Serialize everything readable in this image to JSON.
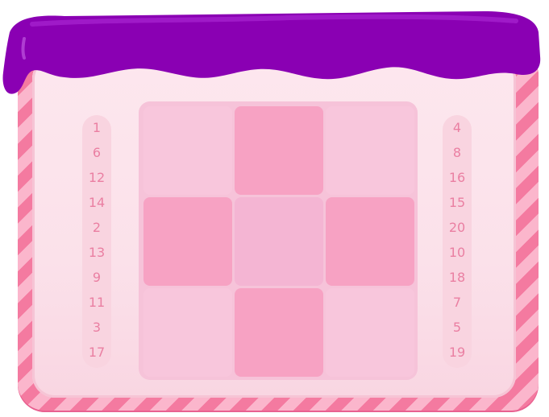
{
  "left_numbers": [
    "1",
    "6",
    "12",
    "14",
    "2",
    "13",
    "9",
    "11",
    "3",
    "17"
  ],
  "right_numbers": [
    "4",
    "8",
    "16",
    "15",
    "20",
    "10",
    "18",
    "7",
    "5",
    "19"
  ],
  "grid": {
    "rows": 3,
    "cols": 3,
    "filled_cells": [
      [
        0,
        1
      ],
      [
        1,
        0
      ],
      [
        1,
        2
      ],
      [
        2,
        1
      ]
    ]
  },
  "colors": {
    "slime": "#8a00b3",
    "slime_highlight": "#b030d8",
    "frame_stripe_dark": "#f47aa0",
    "frame_stripe_light": "#fbb6cc",
    "cell_filled": "#f7a2c3",
    "number_text": "#ea7fa2"
  }
}
